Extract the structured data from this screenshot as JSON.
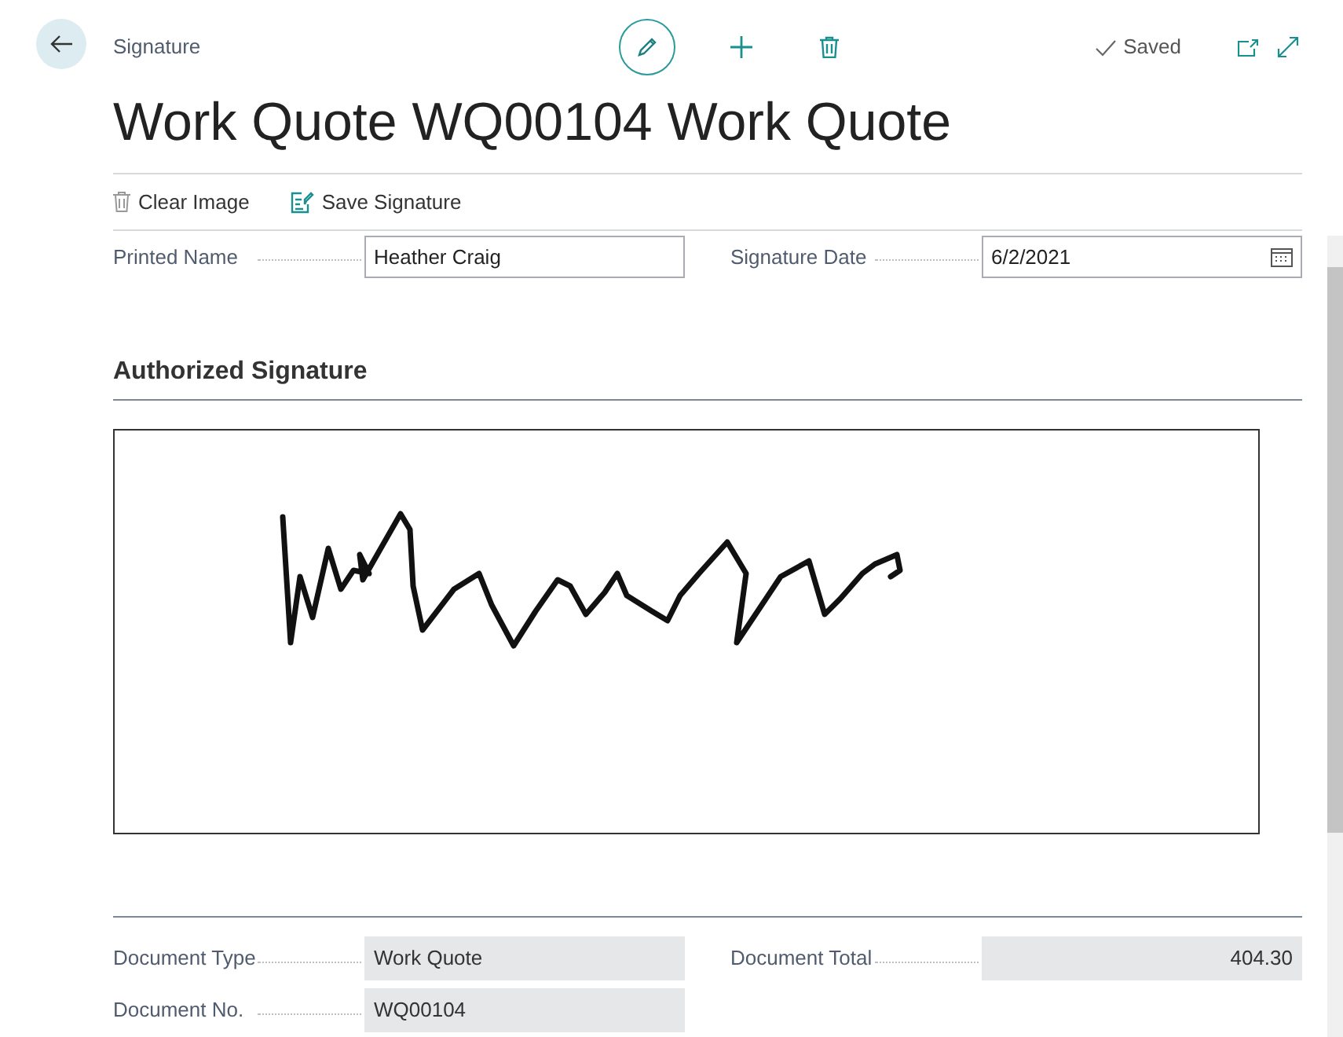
{
  "header": {
    "caption": "Signature",
    "title": "Work Quote WQ00104 Work Quote",
    "status": "Saved"
  },
  "actions": [
    {
      "label": "Clear Image",
      "kind": "clear"
    },
    {
      "label": "Save Signature",
      "kind": "save"
    }
  ],
  "fields": [
    {
      "label": "Printed Name",
      "value": "Heather Craig",
      "kind": "text"
    },
    {
      "label": "Signature Date",
      "value": "6/2/2021",
      "kind": "date"
    }
  ],
  "signature_section": {
    "title": "Authorized Signature"
  },
  "details": [
    {
      "label": "Document Type",
      "value": "Work Quote",
      "kind": "readonly"
    },
    {
      "label": "Document Total",
      "value": "404.30",
      "kind": "amount"
    },
    {
      "label": "Document No.",
      "value": "WQ00104",
      "kind": "readonly"
    }
  ]
}
